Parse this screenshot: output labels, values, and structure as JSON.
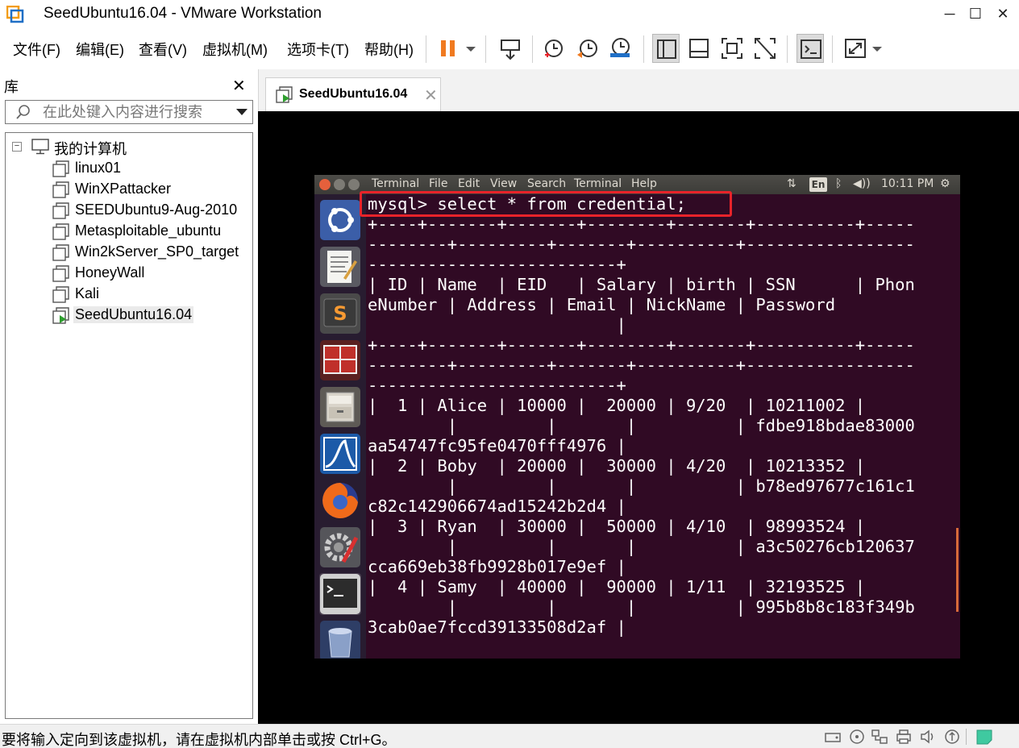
{
  "window": {
    "title": "SeedUbuntu16.04 - VMware Workstation",
    "minimize_glyph": "─",
    "maximize_glyph": "☐",
    "close_glyph": "✕"
  },
  "menu": {
    "items": [
      "文件(F)",
      "编辑(E)",
      "查看(V)",
      "虚拟机(M)",
      "选项卡(T)",
      "帮助(H)"
    ]
  },
  "toolbar": {
    "icons": [
      "pause-icon",
      "send-keys-icon",
      "snapshot-icon",
      "revert-snapshot-icon",
      "snapshot-manager-icon",
      "show-library-icon",
      "thumbnail-bar-icon",
      "full-screen-icon",
      "unity-icon",
      "console-view-icon",
      "stretch-icon"
    ]
  },
  "library": {
    "title": "库",
    "close_glyph": "✕",
    "search_placeholder": "在此处键入内容进行搜索",
    "root": "我的计算机",
    "expander": "−",
    "vms": [
      "linux01",
      "WinXPattacker",
      "SEEDUbuntu9-Aug-2010",
      "Metasploitable_ubuntu",
      "Win2kServer_SP0_target",
      "HoneyWall",
      "Kali",
      "SeedUbuntu16.04"
    ],
    "selected": "SeedUbuntu16.04"
  },
  "tabs": [
    {
      "label": "SeedUbuntu16.04",
      "close_glyph": "✕"
    }
  ],
  "guest_panel": {
    "menus": [
      "Terminal",
      "File",
      "Edit",
      "View",
      "Search",
      "Terminal",
      "Help"
    ],
    "keyboard_layout": "En",
    "network_glyph": "⇅",
    "bluetooth_glyph": "ᛒ",
    "volume_glyph": "◀))",
    "clock": "10:11 PM",
    "settings_glyph": "⚙"
  },
  "launcher": {
    "icons": [
      "ubuntu-dash-icon",
      "text-editor-icon",
      "sublime-text-icon",
      "terminal-red-icon",
      "file-manager-icon",
      "wireshark-icon",
      "firefox-icon",
      "system-settings-icon",
      "terminal-icon",
      "trash-icon"
    ]
  },
  "terminal": {
    "lines": [
      "mysql> select * from credential;",
      "+----+-------+-------+--------+-------+----------+-----",
      "--------+---------+-------+----------+-----------------",
      "-------------------------+",
      "| ID | Name  | EID   | Salary | birth | SSN      | Phon",
      "eNumber | Address | Email | NickName | Password",
      "                         |",
      "+----+-------+-------+--------+-------+----------+-----",
      "--------+---------+-------+----------+-----------------",
      "-------------------------+",
      "|  1 | Alice | 10000 |  20000 | 9/20  | 10211002 |",
      "        |         |       |          | fdbe918bdae83000",
      "aa54747fc95fe0470fff4976 |",
      "|  2 | Boby  | 20000 |  30000 | 4/20  | 10213352 |",
      "        |         |       |          | b78ed97677c161c1",
      "c82c142906674ad15242b2d4 |",
      "|  3 | Ryan  | 30000 |  50000 | 4/10  | 98993524 |",
      "        |         |       |          | a3c50276cb120637",
      "cca669eb38fb9928b017e9ef |",
      "|  4 | Samy  | 40000 |  90000 | 1/11  | 32193525 |",
      "        |         |       |          | 995b8b8c183f349b",
      "3cab0ae7fccd39133508d2af |"
    ]
  },
  "status": {
    "text": "要将输入定向到该虚拟机，请在虚拟机内部单击或按 Ctrl+G。",
    "icons": [
      "hard-disk-icon",
      "cd-drive-icon",
      "network-adapter-icon",
      "printer-icon",
      "sound-icon",
      "usb-icon",
      "message-icon"
    ]
  },
  "colors": {
    "terminal_bg": "#300a24",
    "highlight": "#e8232a",
    "pause_orange": "#f07a20",
    "vmware_blue": "#1f6fc6"
  }
}
